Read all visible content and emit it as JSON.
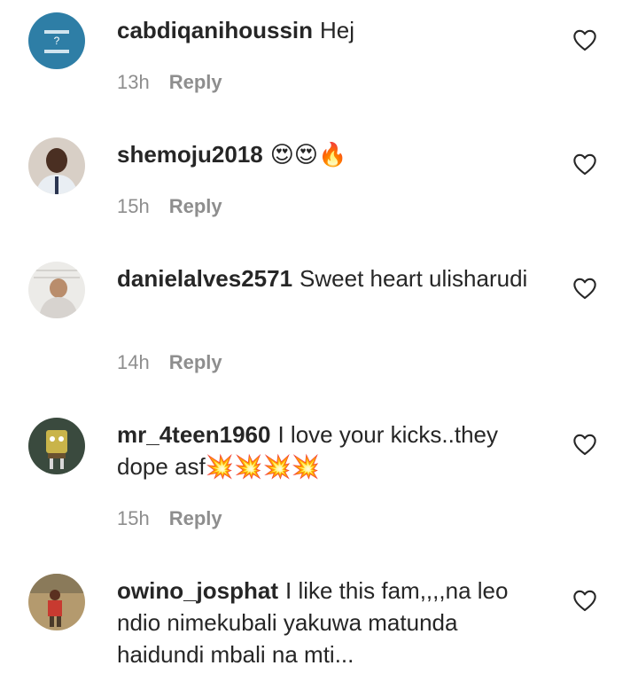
{
  "comments": [
    {
      "username": "cabdiqanihoussin",
      "text": "Hej",
      "time": "13h",
      "reply": "Reply"
    },
    {
      "username": "shemoju2018",
      "text": "😍😍🔥",
      "time": "15h",
      "reply": "Reply"
    },
    {
      "username": "danielalves2571",
      "text": "Sweet heart ulisharudi",
      "time": "14h",
      "reply": "Reply"
    },
    {
      "username": "mr_4teen1960",
      "text": "I love your kicks..they dope asf💥💥💥💥",
      "time": "15h",
      "reply": "Reply"
    },
    {
      "username": "owino_josphat",
      "text": "I like this fam,,,,na leo ndio nimekubali yakuwa matunda haidundi mbali na mti...",
      "time": "",
      "reply": ""
    }
  ],
  "icons": {
    "like": "heart-outline-icon",
    "avatar_colors": [
      "#2e7ea6",
      "#c9b8a8",
      "#d9d6d2",
      "#3a4a3e",
      "#7a5a3a"
    ]
  }
}
